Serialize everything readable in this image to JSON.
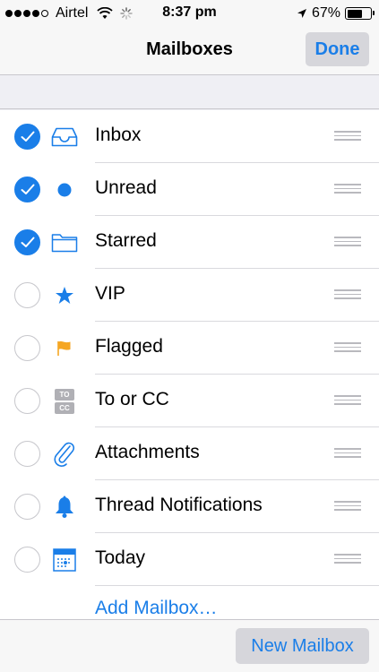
{
  "status_bar": {
    "signal_dots": 5,
    "signal_filled": 4,
    "carrier": "Airtel",
    "time": "8:37 pm",
    "battery_percent": "67%",
    "battery_level": 0.67
  },
  "nav": {
    "title": "Mailboxes",
    "done_label": "Done"
  },
  "mailboxes": [
    {
      "label": "Inbox",
      "checked": true,
      "icon": "inbox-tray-icon"
    },
    {
      "label": "Unread",
      "checked": true,
      "icon": "unread-dot-icon"
    },
    {
      "label": "Starred",
      "checked": true,
      "icon": "folder-icon"
    },
    {
      "label": "VIP",
      "checked": false,
      "icon": "star-icon"
    },
    {
      "label": "Flagged",
      "checked": false,
      "icon": "flag-icon"
    },
    {
      "label": "To or CC",
      "checked": false,
      "icon": "to-cc-icon",
      "icon_text": [
        "TO",
        "CC"
      ]
    },
    {
      "label": "Attachments",
      "checked": false,
      "icon": "paperclip-icon"
    },
    {
      "label": "Thread Notifications",
      "checked": false,
      "icon": "bell-icon"
    },
    {
      "label": "Today",
      "checked": false,
      "icon": "calendar-icon"
    }
  ],
  "add_mailbox_label": "Add Mailbox…",
  "toolbar": {
    "new_mailbox_label": "New Mailbox"
  },
  "colors": {
    "accent": "#1a7ee8",
    "flag": "#f5a623"
  }
}
